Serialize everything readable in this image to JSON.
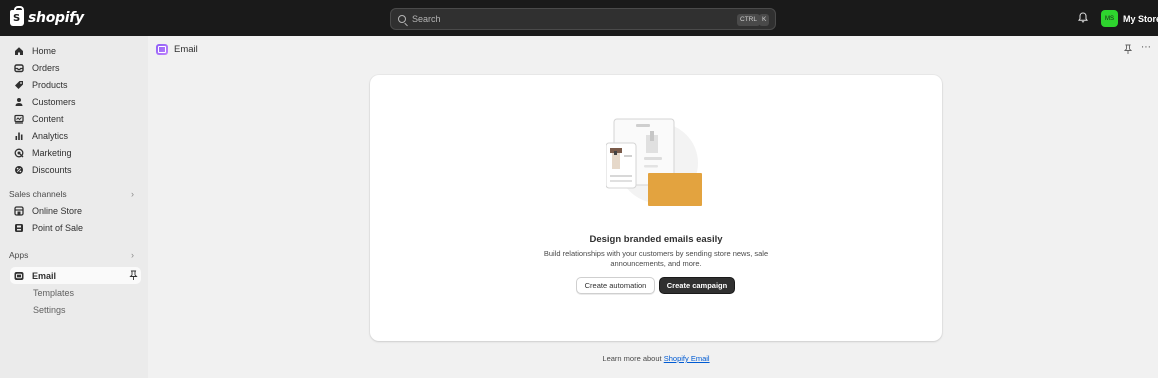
{
  "topbar": {
    "brand": "shopify",
    "search_placeholder": "Search",
    "shortcut_ctrl": "CTRL",
    "shortcut_key": "K",
    "store_initials": "MS",
    "store_name": "My Store"
  },
  "sidebar": {
    "items": [
      {
        "label": "Home",
        "icon": "home-icon"
      },
      {
        "label": "Orders",
        "icon": "orders-icon"
      },
      {
        "label": "Products",
        "icon": "tag-icon"
      },
      {
        "label": "Customers",
        "icon": "person-icon"
      },
      {
        "label": "Content",
        "icon": "content-icon"
      },
      {
        "label": "Analytics",
        "icon": "bar-chart-icon"
      },
      {
        "label": "Marketing",
        "icon": "target-icon"
      },
      {
        "label": "Discounts",
        "icon": "discount-icon"
      }
    ],
    "sales_channels_label": "Sales channels",
    "channels": [
      {
        "label": "Online Store",
        "icon": "storefront-icon"
      },
      {
        "label": "Point of Sale",
        "icon": "pos-icon"
      }
    ],
    "apps_label": "Apps",
    "active_app": "Email",
    "app_subitems": [
      "Templates",
      "Settings"
    ]
  },
  "main": {
    "page_title": "Email",
    "empty_state": {
      "title": "Design branded emails easily",
      "description": "Build relationships with your customers by sending store news, sale announcements, and more.",
      "secondary_action": "Create automation",
      "primary_action": "Create campaign"
    },
    "footer_prefix": "Learn more about",
    "footer_link": "Shopify Email"
  },
  "colors": {
    "topbar_bg": "#1a1a1a",
    "sidebar_bg": "#ebebeb",
    "main_bg": "#f1f1f1",
    "store_avatar": "#2ed42e",
    "primary_button": "#303030",
    "link": "#005bd3",
    "illustration_accent": "#e3a33f"
  }
}
